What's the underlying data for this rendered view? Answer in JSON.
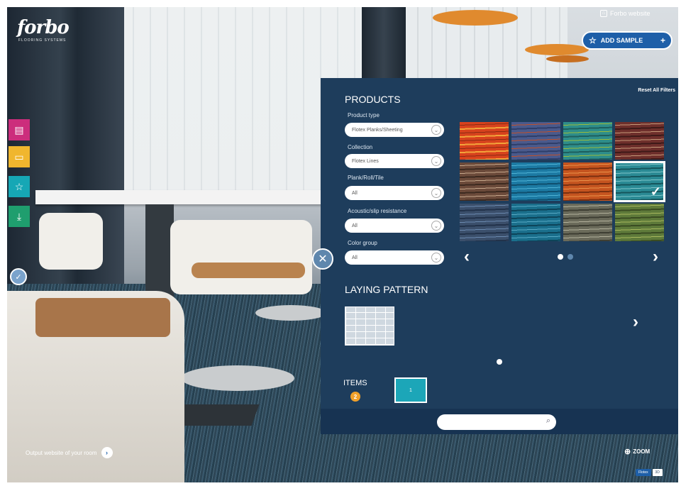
{
  "brand": {
    "name": "forbo",
    "tagline": "FLOORING SYSTEMS"
  },
  "top": {
    "website_link": "Forbo website",
    "add_sample_label": "ADD SAMPLE"
  },
  "icons": {
    "toolbar": [
      "rooms-icon",
      "folder-icon",
      "star-icon",
      "download-icon",
      "info-icon"
    ],
    "accent_colors": {
      "pink": "#cc2d7c",
      "yellow": "#f0b62e",
      "teal": "#16a7b5",
      "green": "#1f9e6e",
      "panel": "#1e3d5c"
    }
  },
  "panel": {
    "products_title": "PRODUCTS",
    "reset_filters": "Reset All Filters",
    "filters": [
      {
        "label": "Product type",
        "value": "Flotex Planks/Sheeting"
      },
      {
        "label": "Collection",
        "value": "Flotex Lines"
      },
      {
        "label": "Plank/Roll/Tile",
        "value": "All"
      },
      {
        "label": "Acoustic/slip resistance",
        "value": "All"
      },
      {
        "label": "Color group",
        "value": "All"
      }
    ],
    "swatches": [
      {
        "colors": [
          "#d7421d",
          "#8a2b12",
          "#f2a43a"
        ],
        "selected": false
      },
      {
        "colors": [
          "#4a5a8c",
          "#c0502a",
          "#2f3e6a"
        ],
        "selected": false
      },
      {
        "colors": [
          "#2e8d8a",
          "#9bbb3a",
          "#1d5f5d"
        ],
        "selected": false
      },
      {
        "colors": [
          "#6e2f2b",
          "#c69a7a",
          "#3e1a18"
        ],
        "selected": false
      },
      {
        "colors": [
          "#6b4a3a",
          "#c7a88c",
          "#3d2a20"
        ],
        "selected": false
      },
      {
        "colors": [
          "#1c7aa3",
          "#4fb2d4",
          "#0f4f6e"
        ],
        "selected": false
      },
      {
        "colors": [
          "#c5541f",
          "#e9924a",
          "#7a2f10"
        ],
        "selected": false
      },
      {
        "colors": [
          "#2a8a94",
          "#7fc4c9",
          "#15555c"
        ],
        "selected": true
      },
      {
        "colors": [
          "#3b4f6b",
          "#6b8ab0",
          "#22324a"
        ],
        "selected": false
      },
      {
        "colors": [
          "#1a6f8c",
          "#58a9c4",
          "#0d4459"
        ],
        "selected": false
      },
      {
        "colors": [
          "#6a6a5a",
          "#b3b19c",
          "#3e3e33"
        ],
        "selected": false
      },
      {
        "colors": [
          "#5e7a3a",
          "#a8b85e",
          "#3a4c22"
        ],
        "selected": false
      }
    ],
    "laying_pattern_title": "LAYING PATTERN",
    "items_label": "ITEMS",
    "items_count": "2",
    "items_thumb_label": "1",
    "search_placeholder": ""
  },
  "bottom": {
    "output_text": "Output website of your room",
    "zoom_label": "ZOOM",
    "corner_pill": "Flotex",
    "corner_square": "3D"
  }
}
